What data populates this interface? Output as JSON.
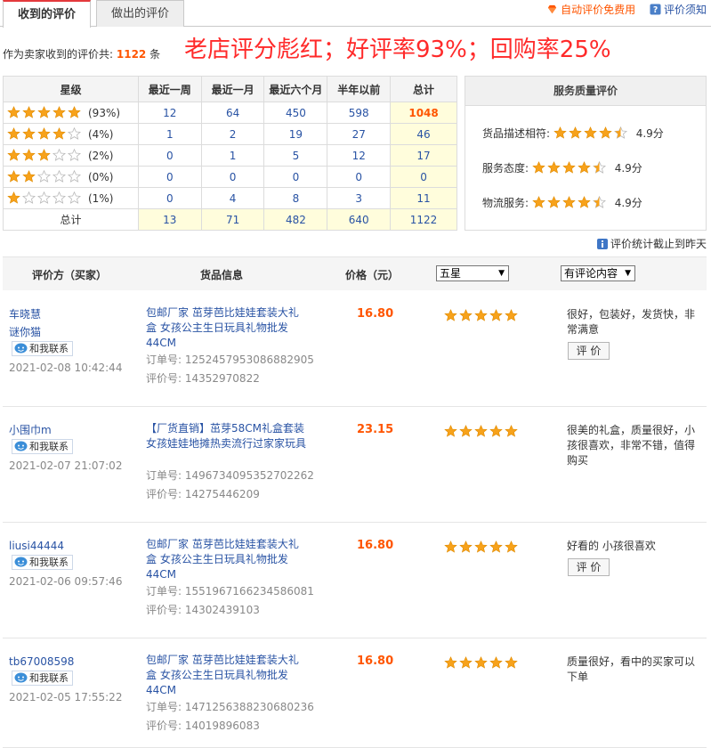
{
  "tabs": {
    "received": "收到的评价",
    "given": "做出的评价"
  },
  "toplinks": {
    "auto_free": "自动评价免费用",
    "help": "评价须知"
  },
  "summary": {
    "prefix": "作为卖家收到的评价共:",
    "count": "1122",
    "suffix": "条"
  },
  "banner": "老店评分彪红；好评率93%；回购率25%",
  "rate_table": {
    "headers": [
      "星级",
      "最近一周",
      "最近一月",
      "最近六个月",
      "半年以前",
      "总计"
    ],
    "rows": [
      {
        "stars": 5,
        "pct": "(93%)",
        "week": "12",
        "month": "64",
        "six": "450",
        "before": "598",
        "total": "1048"
      },
      {
        "stars": 4,
        "pct": "(4%)",
        "week": "1",
        "month": "2",
        "six": "19",
        "before": "27",
        "total": "46"
      },
      {
        "stars": 3,
        "pct": "(2%)",
        "week": "0",
        "month": "1",
        "six": "5",
        "before": "12",
        "total": "17"
      },
      {
        "stars": 2,
        "pct": "(0%)",
        "week": "0",
        "month": "0",
        "six": "0",
        "before": "0",
        "total": "0"
      },
      {
        "stars": 1,
        "pct": "(1%)",
        "week": "0",
        "month": "4",
        "six": "8",
        "before": "3",
        "total": "11"
      }
    ],
    "total_row": {
      "label": "总计",
      "week": "13",
      "month": "71",
      "six": "482",
      "before": "640",
      "total": "1122"
    }
  },
  "service": {
    "title": "服务质量评价",
    "items": [
      {
        "label": "货品描述相符:",
        "rating": 4.5,
        "score": "4.9分"
      },
      {
        "label": "服务态度:",
        "rating": 4.5,
        "score": "4.9分"
      },
      {
        "label": "物流服务:",
        "rating": 4.5,
        "score": "4.9分"
      }
    ]
  },
  "update_note": "评价统计截止到昨天",
  "list_header": {
    "buyer": "评价方（买家）",
    "goods": "货品信息",
    "price": "价格（元）",
    "star_filter": "五星",
    "content_filter": "有评论内容"
  },
  "reviews": [
    {
      "buyer": [
        "车晓慧",
        "谜你猫"
      ],
      "contact": "和我联系",
      "date": "2021-02-08 10:42:44",
      "goods": "包邮厂家 茁芽芭比娃娃套装大礼盒 女孩公主生日玩具礼物批发44CM",
      "order_label": "订单号:",
      "order": "1252457953086882905",
      "review_label": "评价号:",
      "review": "14352970822",
      "price": "16.80",
      "rating": 5,
      "comment": "很好，包装好，发货快，非常满意",
      "button": "评 价"
    },
    {
      "buyer": [
        "小围巾m"
      ],
      "contact": "和我联系",
      "date": "2021-02-07 21:07:02",
      "goods": "【厂货直销】茁芽58CM礼盒套装女孩娃娃地摊热卖流行过家家玩具",
      "order_label": "订单号:",
      "order": "1496734095352702262",
      "review_label": "评价号:",
      "review": "14275446209",
      "price": "23.15",
      "rating": 5,
      "comment": "很美的礼盒，质量很好，小孩很喜欢，非常不错，值得购买",
      "button": ""
    },
    {
      "buyer": [
        "liusi44444"
      ],
      "contact": "和我联系",
      "date": "2021-02-06 09:57:46",
      "goods": "包邮厂家 茁芽芭比娃娃套装大礼盒 女孩公主生日玩具礼物批发44CM",
      "order_label": "订单号:",
      "order": "1551967166234586081",
      "review_label": "评价号:",
      "review": "14302439103",
      "price": "16.80",
      "rating": 5,
      "comment": "好看的 小孩很喜欢",
      "button": "评 价"
    },
    {
      "buyer": [
        "tb67008598"
      ],
      "contact": "和我联系",
      "date": "2021-02-05 17:55:22",
      "goods": "包邮厂家 茁芽芭比娃娃套装大礼盒 女孩公主生日玩具礼物批发44CM",
      "order_label": "订单号:",
      "order": "1471256388230680236",
      "review_label": "评价号:",
      "review": "14019896083",
      "price": "16.80",
      "rating": 5,
      "comment": "质量很好，看中的买家可以下单",
      "button": ""
    }
  ],
  "colors": {
    "accent": "#ff5500",
    "link": "#2953a4",
    "star": "#f7a21b",
    "banner": "#ff2a2a"
  }
}
